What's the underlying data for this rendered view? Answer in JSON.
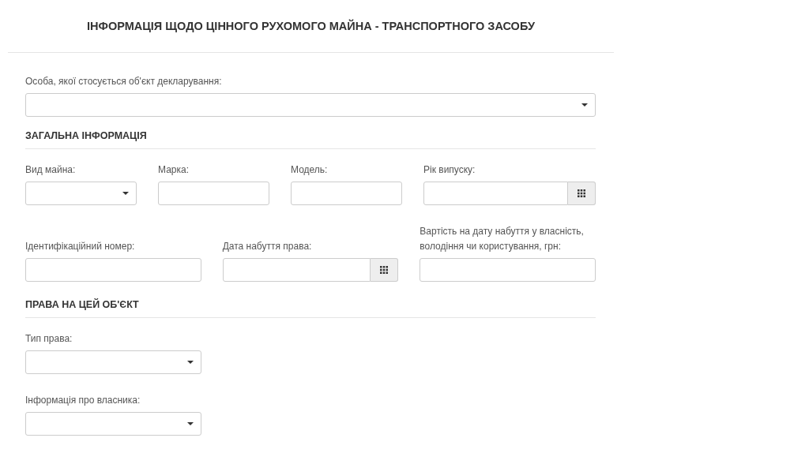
{
  "title": "ІНФОРМАЦІЯ ЩОДО ЦІННОГО РУХОМОГО МАЙНА - ТРАНСПОРТНОГО ЗАСОБУ",
  "owner_field": {
    "label": "Особа, якої стосується об'єкт декларування:",
    "kind": "select"
  },
  "sections": [
    {
      "title": "ЗАГАЛЬНА ІНФОРМАЦІЯ",
      "rows": [
        {
          "fields": [
            {
              "label": "Вид майна:",
              "kind": "select"
            },
            {
              "label": "Марка:",
              "kind": "text"
            },
            {
              "label": "Модель:",
              "kind": "text"
            },
            {
              "label": "Рік випуску:",
              "kind": "date"
            }
          ]
        },
        {
          "fields": [
            {
              "label": "Ідентифікаційний номер:",
              "kind": "text"
            },
            {
              "label": "Дата набуття права:",
              "kind": "date"
            },
            {
              "label": "Вартість на дату набуття у власність, володіння чи користування, грн:",
              "kind": "text"
            }
          ]
        }
      ]
    },
    {
      "title": "ПРАВА НА ЦЕЙ ОБ'ЄКТ",
      "rows": [
        {
          "fields": [
            {
              "label": "Тип права:",
              "kind": "select"
            }
          ]
        },
        {
          "fields": [
            {
              "label": "Інформація про власника:",
              "kind": "select"
            }
          ]
        }
      ]
    }
  ]
}
